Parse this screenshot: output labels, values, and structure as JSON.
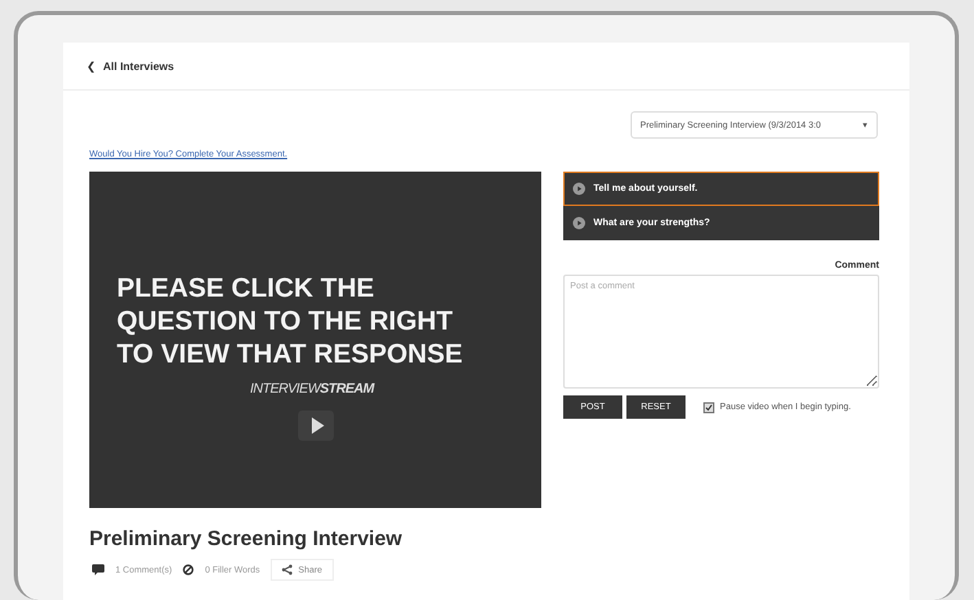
{
  "back_link": {
    "icon": "❮",
    "label": "All Interviews"
  },
  "interview_select": {
    "value": "Preliminary Screening Interview (9/3/2014 3:0",
    "caret": "▾"
  },
  "assessment_link": "Would You Hire You? Complete Your Assessment.",
  "video": {
    "message": [
      "PLEASE CLICK THE",
      "QUESTION TO THE RIGHT",
      "TO VIEW THAT RESPONSE"
    ],
    "logo": "INTERVIEW**STREAM**"
  },
  "questions": [
    {
      "label": "Tell me about yourself.",
      "selected": true
    },
    {
      "label": "What are your strengths?",
      "selected": false
    }
  ],
  "comment": {
    "label": "Comment",
    "placeholder": "Post a comment",
    "buttons": [
      "POST",
      "RESET"
    ],
    "pause_option": {
      "label": "Pause video when I begin typing.",
      "checked": true
    }
  },
  "title": "Preliminary Screening Interview",
  "meta": {
    "comments": "1 Comment(s)",
    "filler_words": "0 Filler Words",
    "share": "Share"
  }
}
